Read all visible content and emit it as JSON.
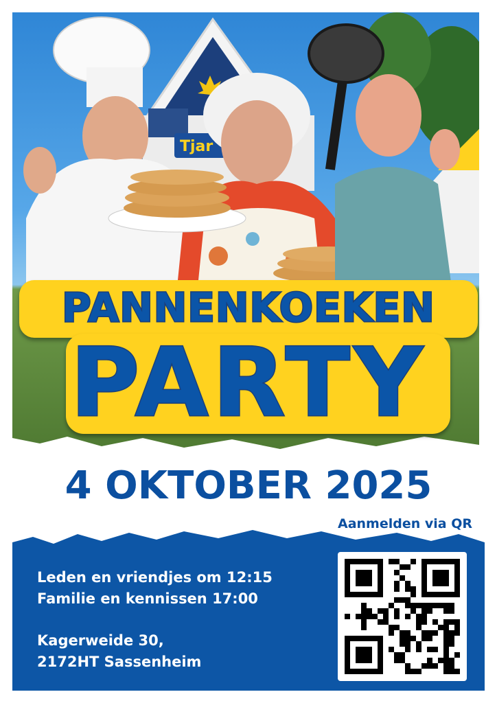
{
  "photo": {
    "sign_text": "Tjar"
  },
  "title": {
    "line1": "PANNENKOEKEN",
    "line2": "PARTY"
  },
  "event": {
    "date": "4 OKTOBER 2025",
    "qr_note": "Aanmelden via QR",
    "times": [
      "Leden en vriendjes om 12:15",
      "Familie en kennissen 17:00"
    ],
    "address": [
      "Kagerweide 30,",
      "2172HT Sassenheim"
    ]
  },
  "colors": {
    "brand_blue": "#0b55a8",
    "title_yellow": "#ffd21f",
    "footer_blue": "#0d56a6"
  }
}
